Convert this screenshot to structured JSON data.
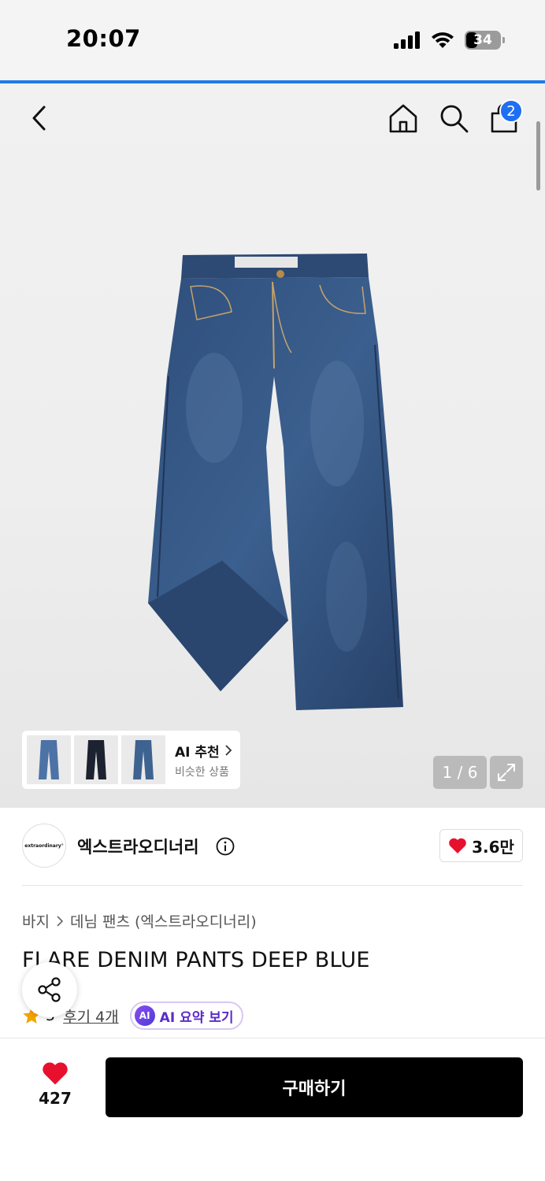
{
  "status_bar": {
    "time": "20:07",
    "battery": "34",
    "battery_level": 0.34
  },
  "nav": {
    "cart_count": "2"
  },
  "gallery": {
    "ai_recommend_title": "AI 추천",
    "ai_recommend_subtitle": "비슷한 상품",
    "page_indicator": "1 / 6",
    "product_image": "jeans-image"
  },
  "brand": {
    "logo_text": "extraordinary°",
    "name": "엑스트라오디너리",
    "likes": "3.6만"
  },
  "product": {
    "breadcrumb": [
      "바지",
      "데님 팬츠 (엑스트라오디너리)"
    ],
    "title": "FLARE DENIM PANTS DEEP BLUE",
    "rating": "5",
    "reviews": "후기 4개",
    "ai_badge": "AI",
    "ai_summary": "AI 요약 보기"
  },
  "bottom_bar": {
    "like_count": "427",
    "buy_label": "구매하기"
  },
  "colors": {
    "accent_blue": "#1f6ff2",
    "heart_red": "#e8112d",
    "star_orange": "#f5a300",
    "ai_purple": "#5b2bc8"
  }
}
